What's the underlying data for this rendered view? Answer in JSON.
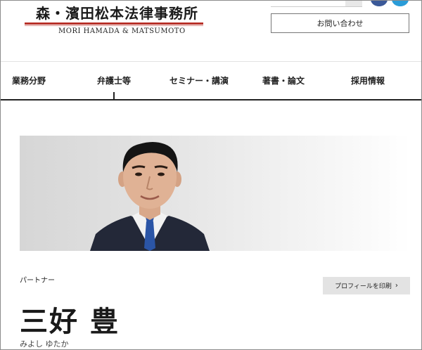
{
  "header": {
    "logo_jp": "森・濱田松本法律事務所",
    "logo_en": "MORI HAMADA & MATSUMOTO",
    "contact_label": "お問い合わせ"
  },
  "nav": {
    "items": [
      {
        "label": "業務分野"
      },
      {
        "label": "弁護士等"
      },
      {
        "label": "セミナー・講演"
      },
      {
        "label": "著書・論文"
      },
      {
        "label": "採用情報"
      }
    ]
  },
  "profile": {
    "role": "パートナー",
    "print_label": "プロフィールを印刷",
    "name": "三好 豊",
    "kana": "みよし ゆたか"
  },
  "colors": {
    "accent_red": "#b8322a",
    "facebook": "#3b5998",
    "twitter": "#2a9cd8"
  },
  "icons": {
    "print_chevron": "chevron-right-icon",
    "facebook": "facebook-icon",
    "twitter": "twitter-icon"
  }
}
